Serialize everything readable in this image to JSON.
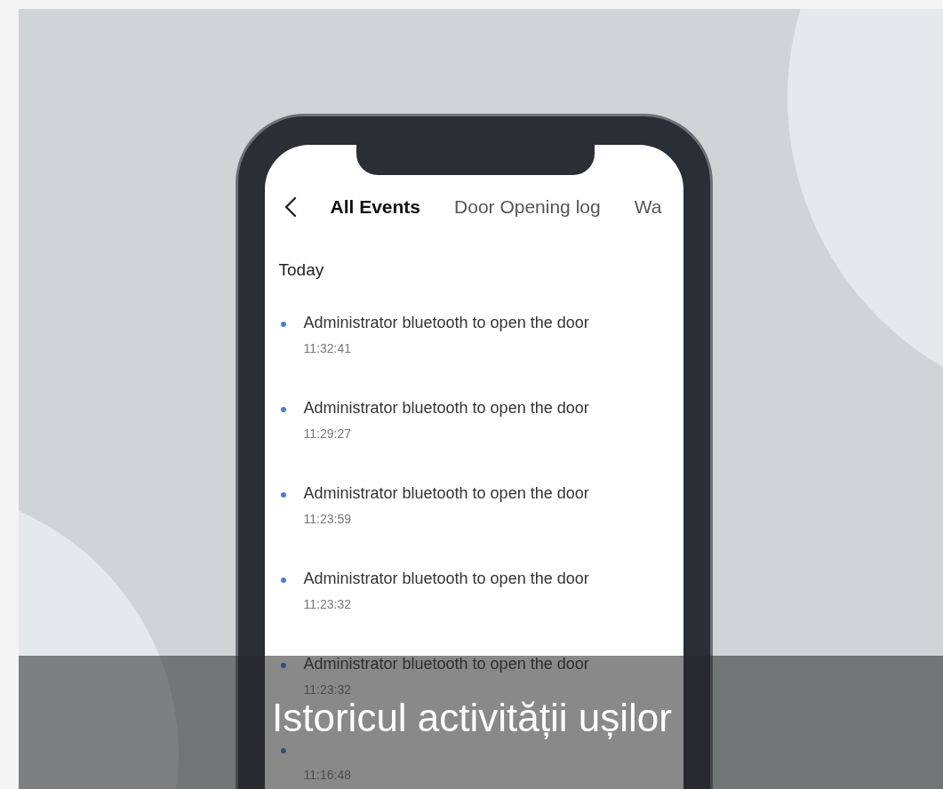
{
  "tabs": [
    {
      "label": "All Events",
      "selected": true
    },
    {
      "label": "Door Opening log",
      "selected": false
    },
    {
      "label": "Wa",
      "selected": false
    }
  ],
  "section": "Today",
  "events": [
    {
      "title": "Administrator bluetooth to open the door",
      "time": "11:32:41"
    },
    {
      "title": "Administrator bluetooth to open the door",
      "time": "11:29:27"
    },
    {
      "title": "Administrator bluetooth to open the door",
      "time": "11:23:59"
    },
    {
      "title": "Administrator bluetooth to open the door",
      "time": "11:23:32"
    },
    {
      "title": "Administrator bluetooth to open the door",
      "time": "11:23:32"
    },
    {
      "time": "11:16:48"
    }
  ],
  "caption": "Istoricul activității ușilor"
}
